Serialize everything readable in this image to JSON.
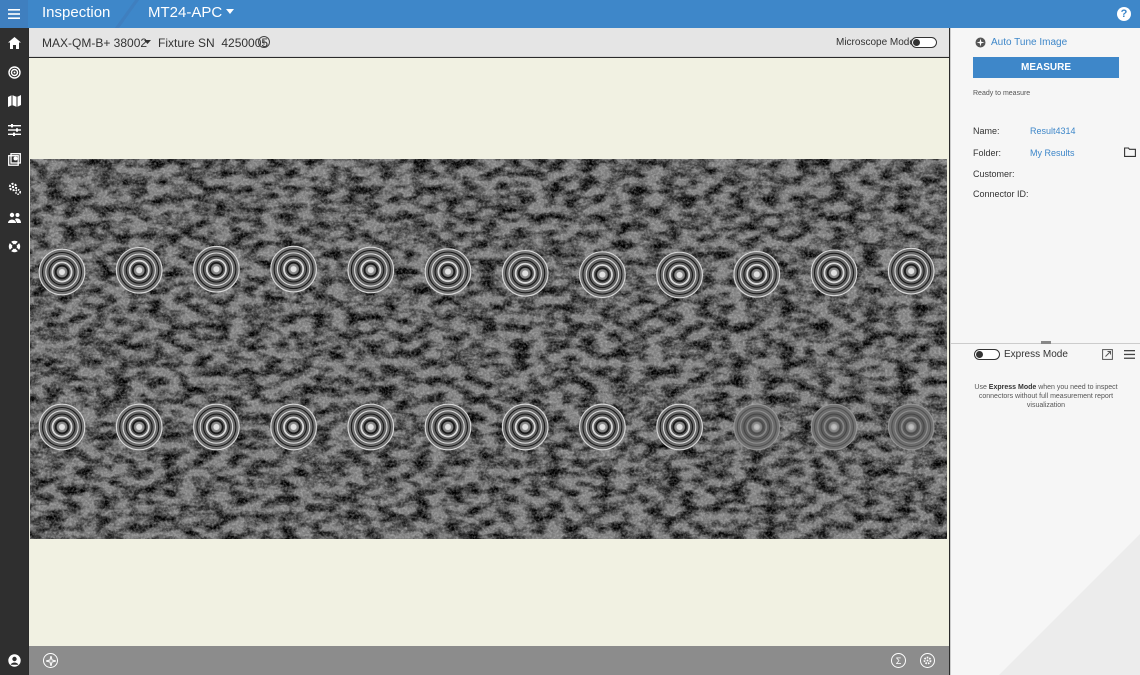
{
  "app": {
    "title": "Inspection",
    "product": "MT24-APC"
  },
  "toolbar": {
    "model": "MAX-QM-B+ 38002",
    "fixture_label": "Fixture SN",
    "fixture_sn": "4250005",
    "info_glyph": "i",
    "microscope_mode_label": "Microscope Mode",
    "microscope_mode_on": false
  },
  "nav": {
    "items": [
      "menu-icon",
      "home-icon",
      "target-icon",
      "map-icon",
      "sliders-icon",
      "gallery-icon",
      "cogs-icon",
      "users-icon",
      "lifebuoy-icon",
      "account-icon"
    ]
  },
  "right_panel": {
    "auto_tune_label": "Auto Tune Image",
    "measure_label": "MEASURE",
    "status": "Ready to measure",
    "fields": {
      "name_label": "Name:",
      "name_value": "Result4314",
      "folder_label": "Folder:",
      "folder_value": "My Results",
      "customer_label": "Customer:",
      "connector_label": "Connector ID:"
    },
    "express_mode_label": "Express Mode",
    "express_mode_on": false,
    "express_help_pre": "Use ",
    "express_help_bold": "Express Mode",
    "express_help_post": " when you need to inspect connectors without full measurement report visualization"
  },
  "help_glyph": "?",
  "bottom": {
    "sigma_glyph": "Σ"
  },
  "colors": {
    "accent": "#3e87c9",
    "nav_bg": "#2f2f2f",
    "viewer_bg": "#f1f1e2",
    "bottom_bar": "#8c8c8c"
  },
  "interferogram": {
    "rows": 2,
    "fibers_per_row": 12
  }
}
